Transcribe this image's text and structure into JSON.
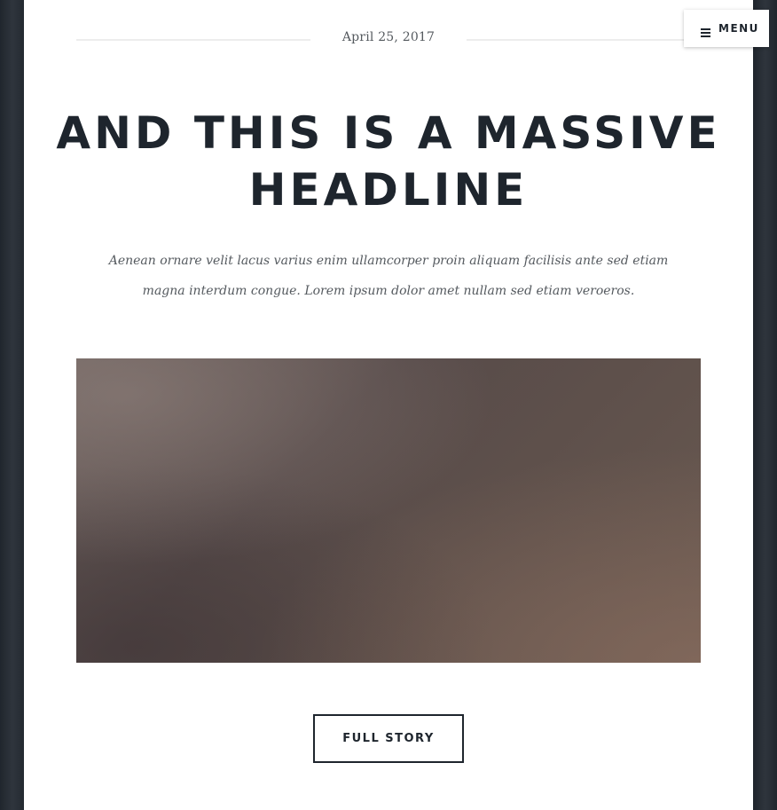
{
  "post": {
    "date": "April 25, 2017",
    "headline": "And this is a massive headline",
    "excerpt": "Aenean ornare velit lacus varius enim ullamcorper proin aliquam facilisis ante sed etiam magna interdum congue. Lorem ipsum dolor amet nullam sed etiam veroeros.",
    "image_icon": "post-image",
    "cta_label": "Full Story"
  },
  "nav": {
    "menu_label": "Menu",
    "menu_icon": "hamburger-icon"
  },
  "colors": {
    "text_dark": "#1e252d",
    "text_muted": "#555a5f",
    "background": "#2a3038",
    "panel": "#ffffff"
  }
}
